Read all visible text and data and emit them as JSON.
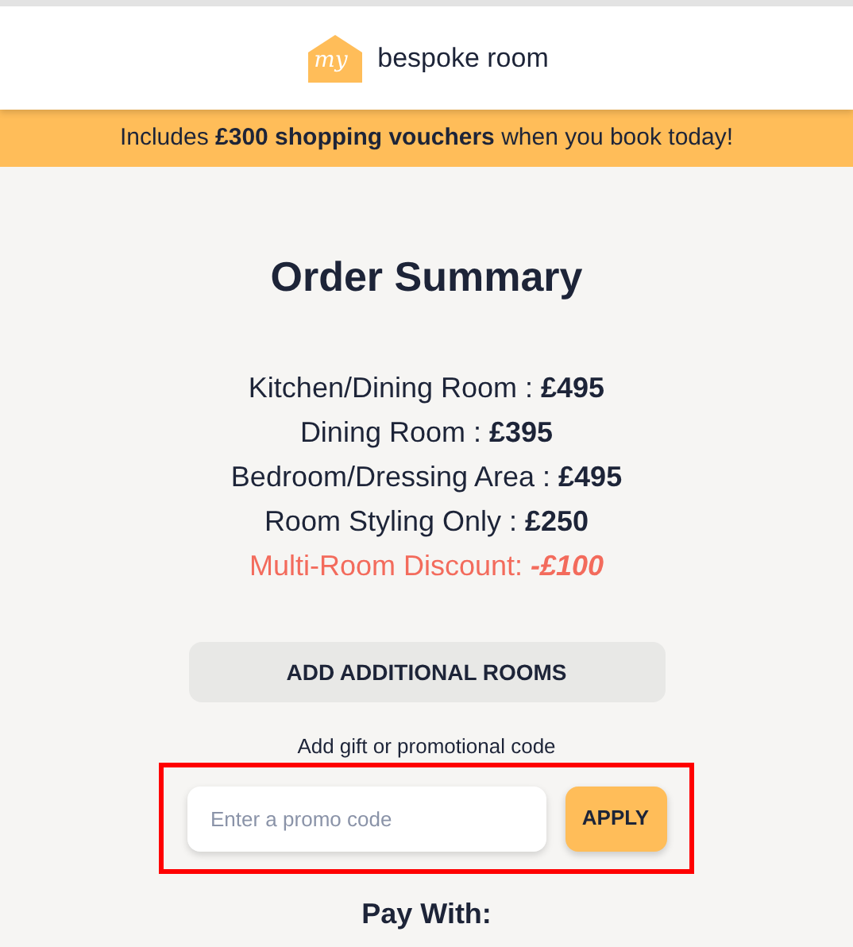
{
  "header": {
    "logo_mark": "my",
    "logo_text": "bespoke room"
  },
  "banner": {
    "text": "Includes **£300 shopping vouchers** when you book today!"
  },
  "order_summary": {
    "title": "Order Summary",
    "lines": [
      {
        "kind": "item",
        "label": "Kitchen/Dining Room :",
        "price": "£495"
      },
      {
        "kind": "item",
        "label": "Dining Room :",
        "price": "£395"
      },
      {
        "kind": "item",
        "label": "Bedroom/Dressing Area :",
        "price": "£495"
      },
      {
        "kind": "item",
        "label": "Room Styling Only :",
        "price": "£250"
      },
      {
        "kind": "discount",
        "label": "Multi-Room Discount:",
        "price": "-£100"
      }
    ],
    "add_rooms_button": "ADD ADDITIONAL ROOMS"
  },
  "promo": {
    "label": "Add gift or promotional code",
    "placeholder": "Enter a promo code",
    "button": "APPLY",
    "highlighted": true
  },
  "payment": {
    "title": "Pay With:"
  }
}
